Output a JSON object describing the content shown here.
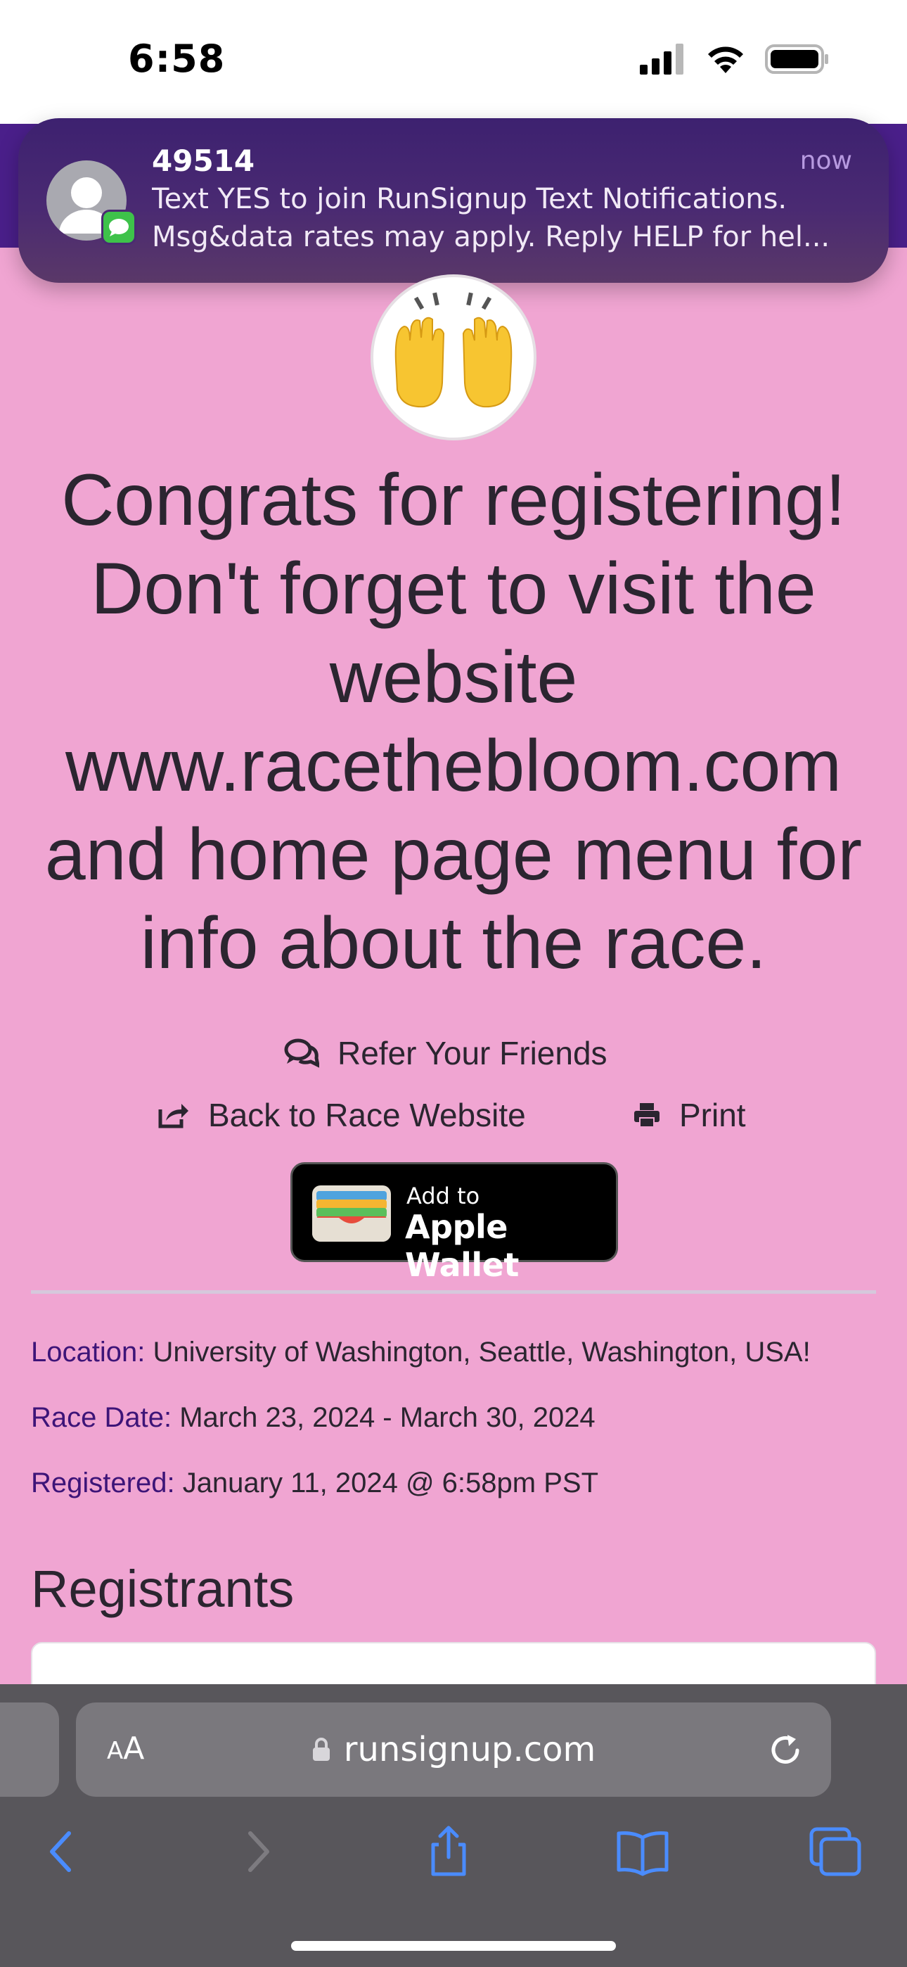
{
  "status_bar": {
    "time": "6:58"
  },
  "notification": {
    "sender": "49514",
    "time": "now",
    "line1": "Text YES to join RunSignup Text Notifications.",
    "line2": "Msg&data rates may apply. Reply HELP for hel..."
  },
  "headline": "Congrats for registering! Don't forget to visit the website www.racethebloom.com and home page menu for info about the race.",
  "actions": {
    "refer": "Refer Your Friends",
    "back": "Back to Race Website",
    "print": "Print"
  },
  "wallet": {
    "small": "Add to",
    "big": "Apple Wallet"
  },
  "details": {
    "location_label": "Location:",
    "location_value": "University of Washington, Seattle, Washington, USA!",
    "date_label": "Race Date:",
    "date_value": "March 23, 2024 - March 30, 2024",
    "registered_label": "Registered:",
    "registered_value": "January 11, 2024 @ 6:58pm PST"
  },
  "registrants_title": "Registrants",
  "browser": {
    "aa_small": "A",
    "aa_large": "A",
    "url": "runsignup.com"
  },
  "icons": {
    "emoji": "raising-hands",
    "refer": "comments-icon",
    "back": "external-link-icon",
    "print": "printer-icon"
  },
  "colors": {
    "page_background": "#f0a5d2",
    "header_purple": "#4a1f8a",
    "label_purple": "#3d1478",
    "toolbar_blue": "#4a8cff"
  }
}
